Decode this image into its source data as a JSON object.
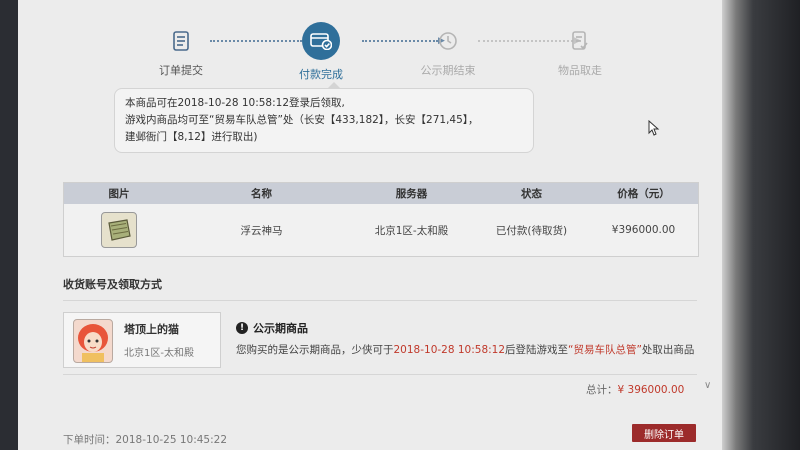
{
  "steps": [
    {
      "label": "订单提交",
      "state": "done",
      "icon": "document-list-icon"
    },
    {
      "label": "付款完成",
      "state": "current",
      "icon": "card-check-icon"
    },
    {
      "label": "公示期结束",
      "state": "todo",
      "icon": "clock-icon"
    },
    {
      "label": "物品取走",
      "state": "todo",
      "icon": "document-check-icon"
    }
  ],
  "tooltip": {
    "line1": "本商品可在2018-10-28 10:58:12登录后领取,",
    "line2": "游戏内商品均可至“贸易车队总管”处（长安【433,182】，长安【271,45】，",
    "line3": "建邺衙门【8,12】进行取出)"
  },
  "table": {
    "headers": [
      "图片",
      "名称",
      "服务器",
      "状态",
      "价格（元）"
    ],
    "rows": [
      {
        "name": "浮云神马",
        "server": "北京1区-太和殿",
        "status": "已付款(待取货)",
        "price": "¥396000.00"
      }
    ]
  },
  "section_title": "收货账号及领取方式",
  "account": {
    "name": "塔顶上的猫",
    "server": "北京1区-太和殿"
  },
  "notice": {
    "title": "公示期商品",
    "text_a": "您购买的是公示期商品，少侠可于",
    "time": "2018-10-28 10:58:12",
    "text_b": "后登陆游戏至",
    "npc": "“贸易车队总管”",
    "text_c": "处取出商品"
  },
  "total": {
    "label": "总计：",
    "amount": "¥ 396000.00"
  },
  "footer": {
    "order_time": "下单时间：2018-10-25 10:45:22"
  },
  "delete_button": "删除订单",
  "colors": {
    "accent": "#2f6f9a",
    "price_red": "#c0392b",
    "delete_button": "#9c2b2b",
    "table_header": "#c9cdd6"
  }
}
